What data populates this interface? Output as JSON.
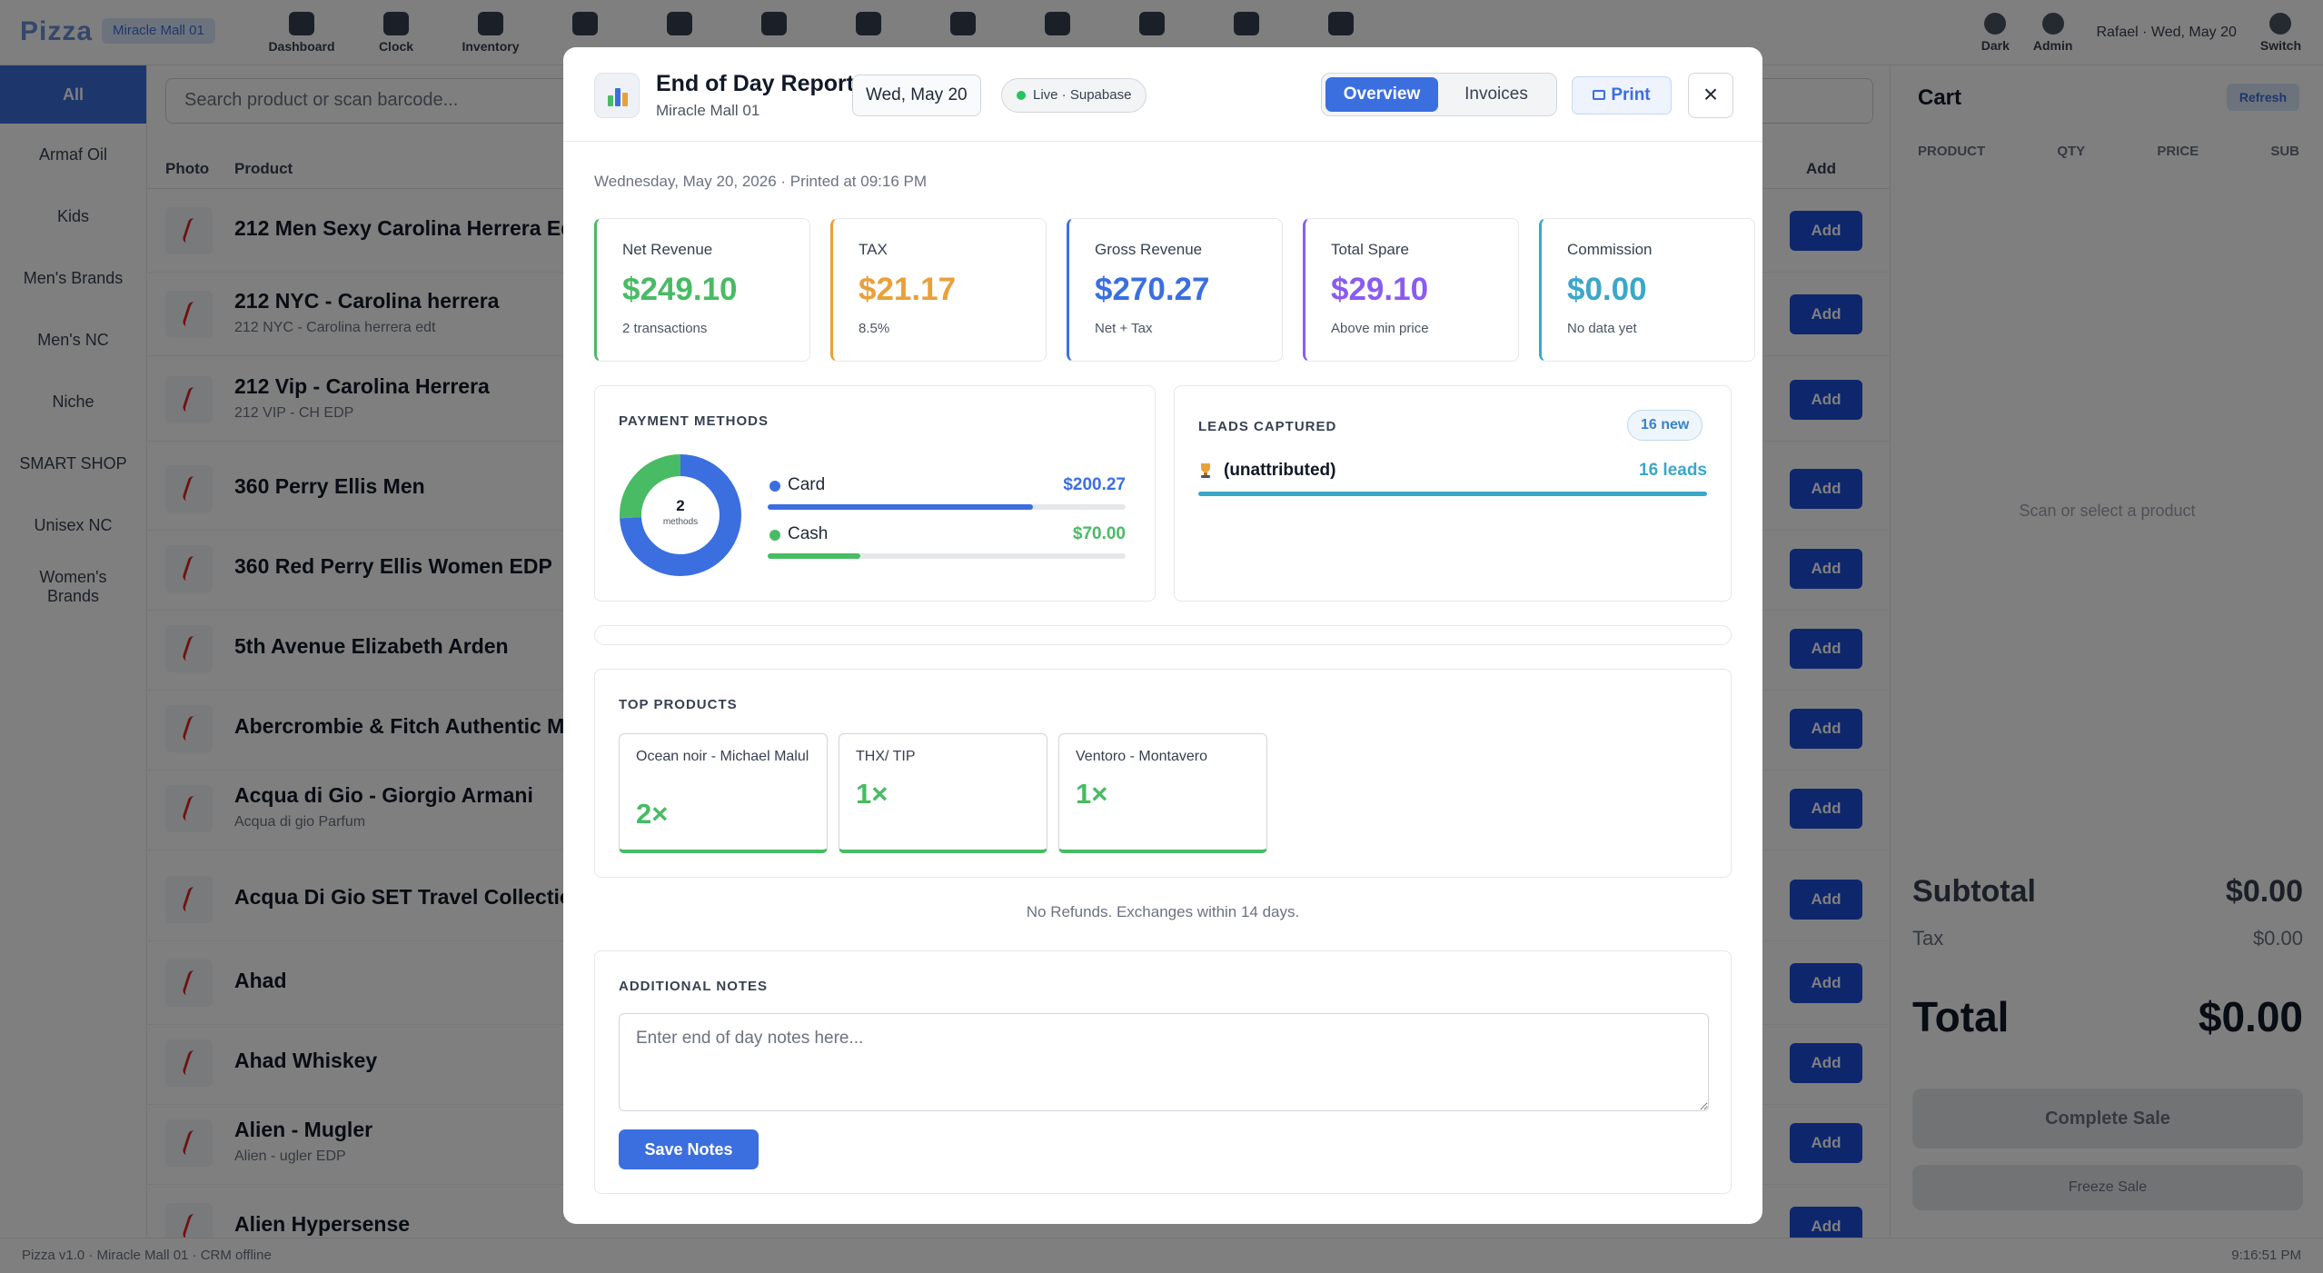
{
  "app": {
    "brand": "Pizza",
    "store_badge": "Miracle Mall 01",
    "nav": [
      "Dashboard",
      "Clock",
      "Inventory",
      "",
      "",
      "",
      "",
      "",
      "",
      "",
      "",
      "",
      ""
    ],
    "top_right": {
      "user": "Rafael · Wed, May 20",
      "dark": "Dark",
      "admin": "Admin",
      "switch": "Switch"
    },
    "categories": [
      "All",
      "Armaf Oil",
      "Kids",
      "Men's Brands",
      "Men's NC",
      "Niche",
      "SMART SHOP",
      "Unisex NC",
      "Women's Brands"
    ],
    "search_placeholder": "Search product or scan barcode...",
    "columns": {
      "photo": "Photo",
      "product": "Product",
      "add": "Add"
    },
    "add_label": "Add",
    "products": [
      {
        "name": "212 Men Sexy Carolina Herrera Ed",
        "sub": ""
      },
      {
        "name": "212 NYC - Carolina herrera",
        "sub": "212 NYC - Carolina herrera edt"
      },
      {
        "name": "212 Vip - Carolina Herrera",
        "sub": "212 VIP - CH EDP"
      },
      {
        "name": "360 Perry Ellis Men",
        "sub": ""
      },
      {
        "name": "360 Red Perry Ellis Women EDP",
        "sub": ""
      },
      {
        "name": "5th Avenue Elizabeth Arden",
        "sub": ""
      },
      {
        "name": "Abercrombie & Fitch Authentic M",
        "sub": ""
      },
      {
        "name": "Acqua di Gio - Giorgio Armani",
        "sub": "Acqua di gio Parfum"
      },
      {
        "name": "Acqua Di Gio SET Travel Collectio",
        "sub": ""
      },
      {
        "name": "Ahad",
        "sub": ""
      },
      {
        "name": "Ahad Whiskey",
        "sub": ""
      },
      {
        "name": "Alien - Mugler",
        "sub": "Alien - ugler EDP"
      },
      {
        "name": "Alien Hypersense",
        "sub": ""
      }
    ],
    "cart": {
      "title": "Cart",
      "refresh": "Refresh",
      "columns": [
        "PRODUCT",
        "QTY",
        "PRICE",
        "SUB"
      ],
      "empty": "Scan or select a product",
      "subtotal_label": "Subtotal",
      "subtotal": "$0.00",
      "tax_label": "Tax",
      "tax": "$0.00",
      "total_label": "Total",
      "total": "$0.00",
      "complete": "Complete Sale",
      "freeze": "Freeze Sale"
    },
    "footer_left": "Pizza v1.0  ·  Miracle Mall 01  ·  CRM offline",
    "footer_right": "9:16:51 PM"
  },
  "modal": {
    "title": "End of Day Report",
    "store": "Miracle Mall 01",
    "date": "Wed, May 20",
    "live": "Live · Supabase",
    "tabs": {
      "overview": "Overview",
      "invoices": "Invoices"
    },
    "print": "Print",
    "close": "×",
    "printed_line": "Wednesday, May 20, 2026 · Printed at 09:16 PM",
    "stats": [
      {
        "label": "Net Revenue",
        "value": "$249.10",
        "sub": "2 transactions",
        "color": "#48bb64"
      },
      {
        "label": "TAX",
        "value": "$21.17",
        "sub": "8.5%",
        "color": "#e8a13a"
      },
      {
        "label": "Gross Revenue",
        "value": "$270.27",
        "sub": "Net + Tax",
        "color": "#3b6fe0"
      },
      {
        "label": "Total Spare",
        "value": "$29.10",
        "sub": "Above min price",
        "color": "#8a5cf0"
      },
      {
        "label": "Commission",
        "value": "$0.00",
        "sub": "No data yet",
        "color": "#3ba7c9"
      }
    ],
    "payment": {
      "heading": "PAYMENT METHODS",
      "count": "2",
      "count_label": "methods",
      "methods": [
        {
          "name": "Card",
          "value": "$200.27",
          "share": 0.741,
          "color": "#3b6fe0"
        },
        {
          "name": "Cash",
          "value": "$70.00",
          "share": 0.259,
          "color": "#48bb64"
        }
      ]
    },
    "leads": {
      "heading": "LEADS CAPTURED",
      "badge": "16 new",
      "rows": [
        {
          "name": "(unattributed)",
          "count": "16 leads",
          "share": 1.0
        }
      ]
    },
    "top_products": {
      "heading": "TOP PRODUCTS",
      "items": [
        {
          "name": "Ocean noir - Michael Malul",
          "qty": "2×"
        },
        {
          "name": "THX/ TIP",
          "qty": "1×"
        },
        {
          "name": "Ventoro - Montavero",
          "qty": "1×"
        }
      ]
    },
    "policy": "No Refunds. Exchanges within 14 days.",
    "notes": {
      "heading": "ADDITIONAL NOTES",
      "placeholder": "Enter end of day notes here...",
      "save": "Save Notes"
    }
  }
}
